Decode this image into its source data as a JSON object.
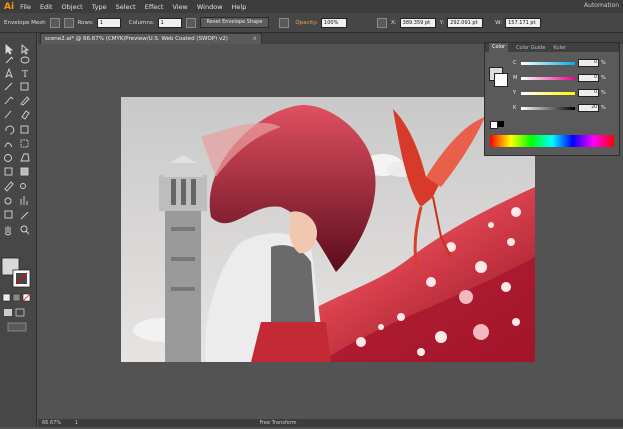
{
  "app": {
    "logo": "Ai",
    "workspace": "Automation"
  },
  "menu": [
    "File",
    "Edit",
    "Object",
    "Type",
    "Select",
    "Effect",
    "View",
    "Window",
    "Help"
  ],
  "control": {
    "envelope_label": "Envelope Mesh",
    "rows_label": "Rows:",
    "rows_value": "1",
    "columns_label": "Columns:",
    "columns_value": "1",
    "reset_button": "Reset Envelope Shape",
    "opacity_label": "Opacity:",
    "opacity_value": "100%",
    "x_label": "X:",
    "x_value": "389.359 pt",
    "y_label": "Y:",
    "y_value": "292.091 pt",
    "w_label": "W:",
    "w_value": "157.171 pt"
  },
  "document": {
    "tab_title": "scene2.ai* @ 66.67% (CMYK/Preview/U.S. Web Coated (SWOP) v2)",
    "close": "×"
  },
  "color_panel": {
    "tabs": [
      "Color",
      "Color Guide",
      "Kuler"
    ],
    "sliders": [
      {
        "label": "C",
        "value": "0",
        "gradient": "linear-gradient(to right,#fff,#00aeef)"
      },
      {
        "label": "M",
        "value": "0",
        "gradient": "linear-gradient(to right,#fff,#ec008c)"
      },
      {
        "label": "Y",
        "value": "0",
        "gradient": "linear-gradient(to right,#fff,#fff200)"
      },
      {
        "label": "K",
        "value": "20",
        "gradient": "linear-gradient(to right,#fff,#000)"
      }
    ],
    "percent": "%"
  },
  "statusbar": {
    "zoom": "66.67%",
    "page": "1",
    "mode": "Free Transform"
  },
  "colors": {
    "accent": "#ff9a00",
    "artwork_red": "#c8283a",
    "panel_bg": "#5a5a5a"
  }
}
